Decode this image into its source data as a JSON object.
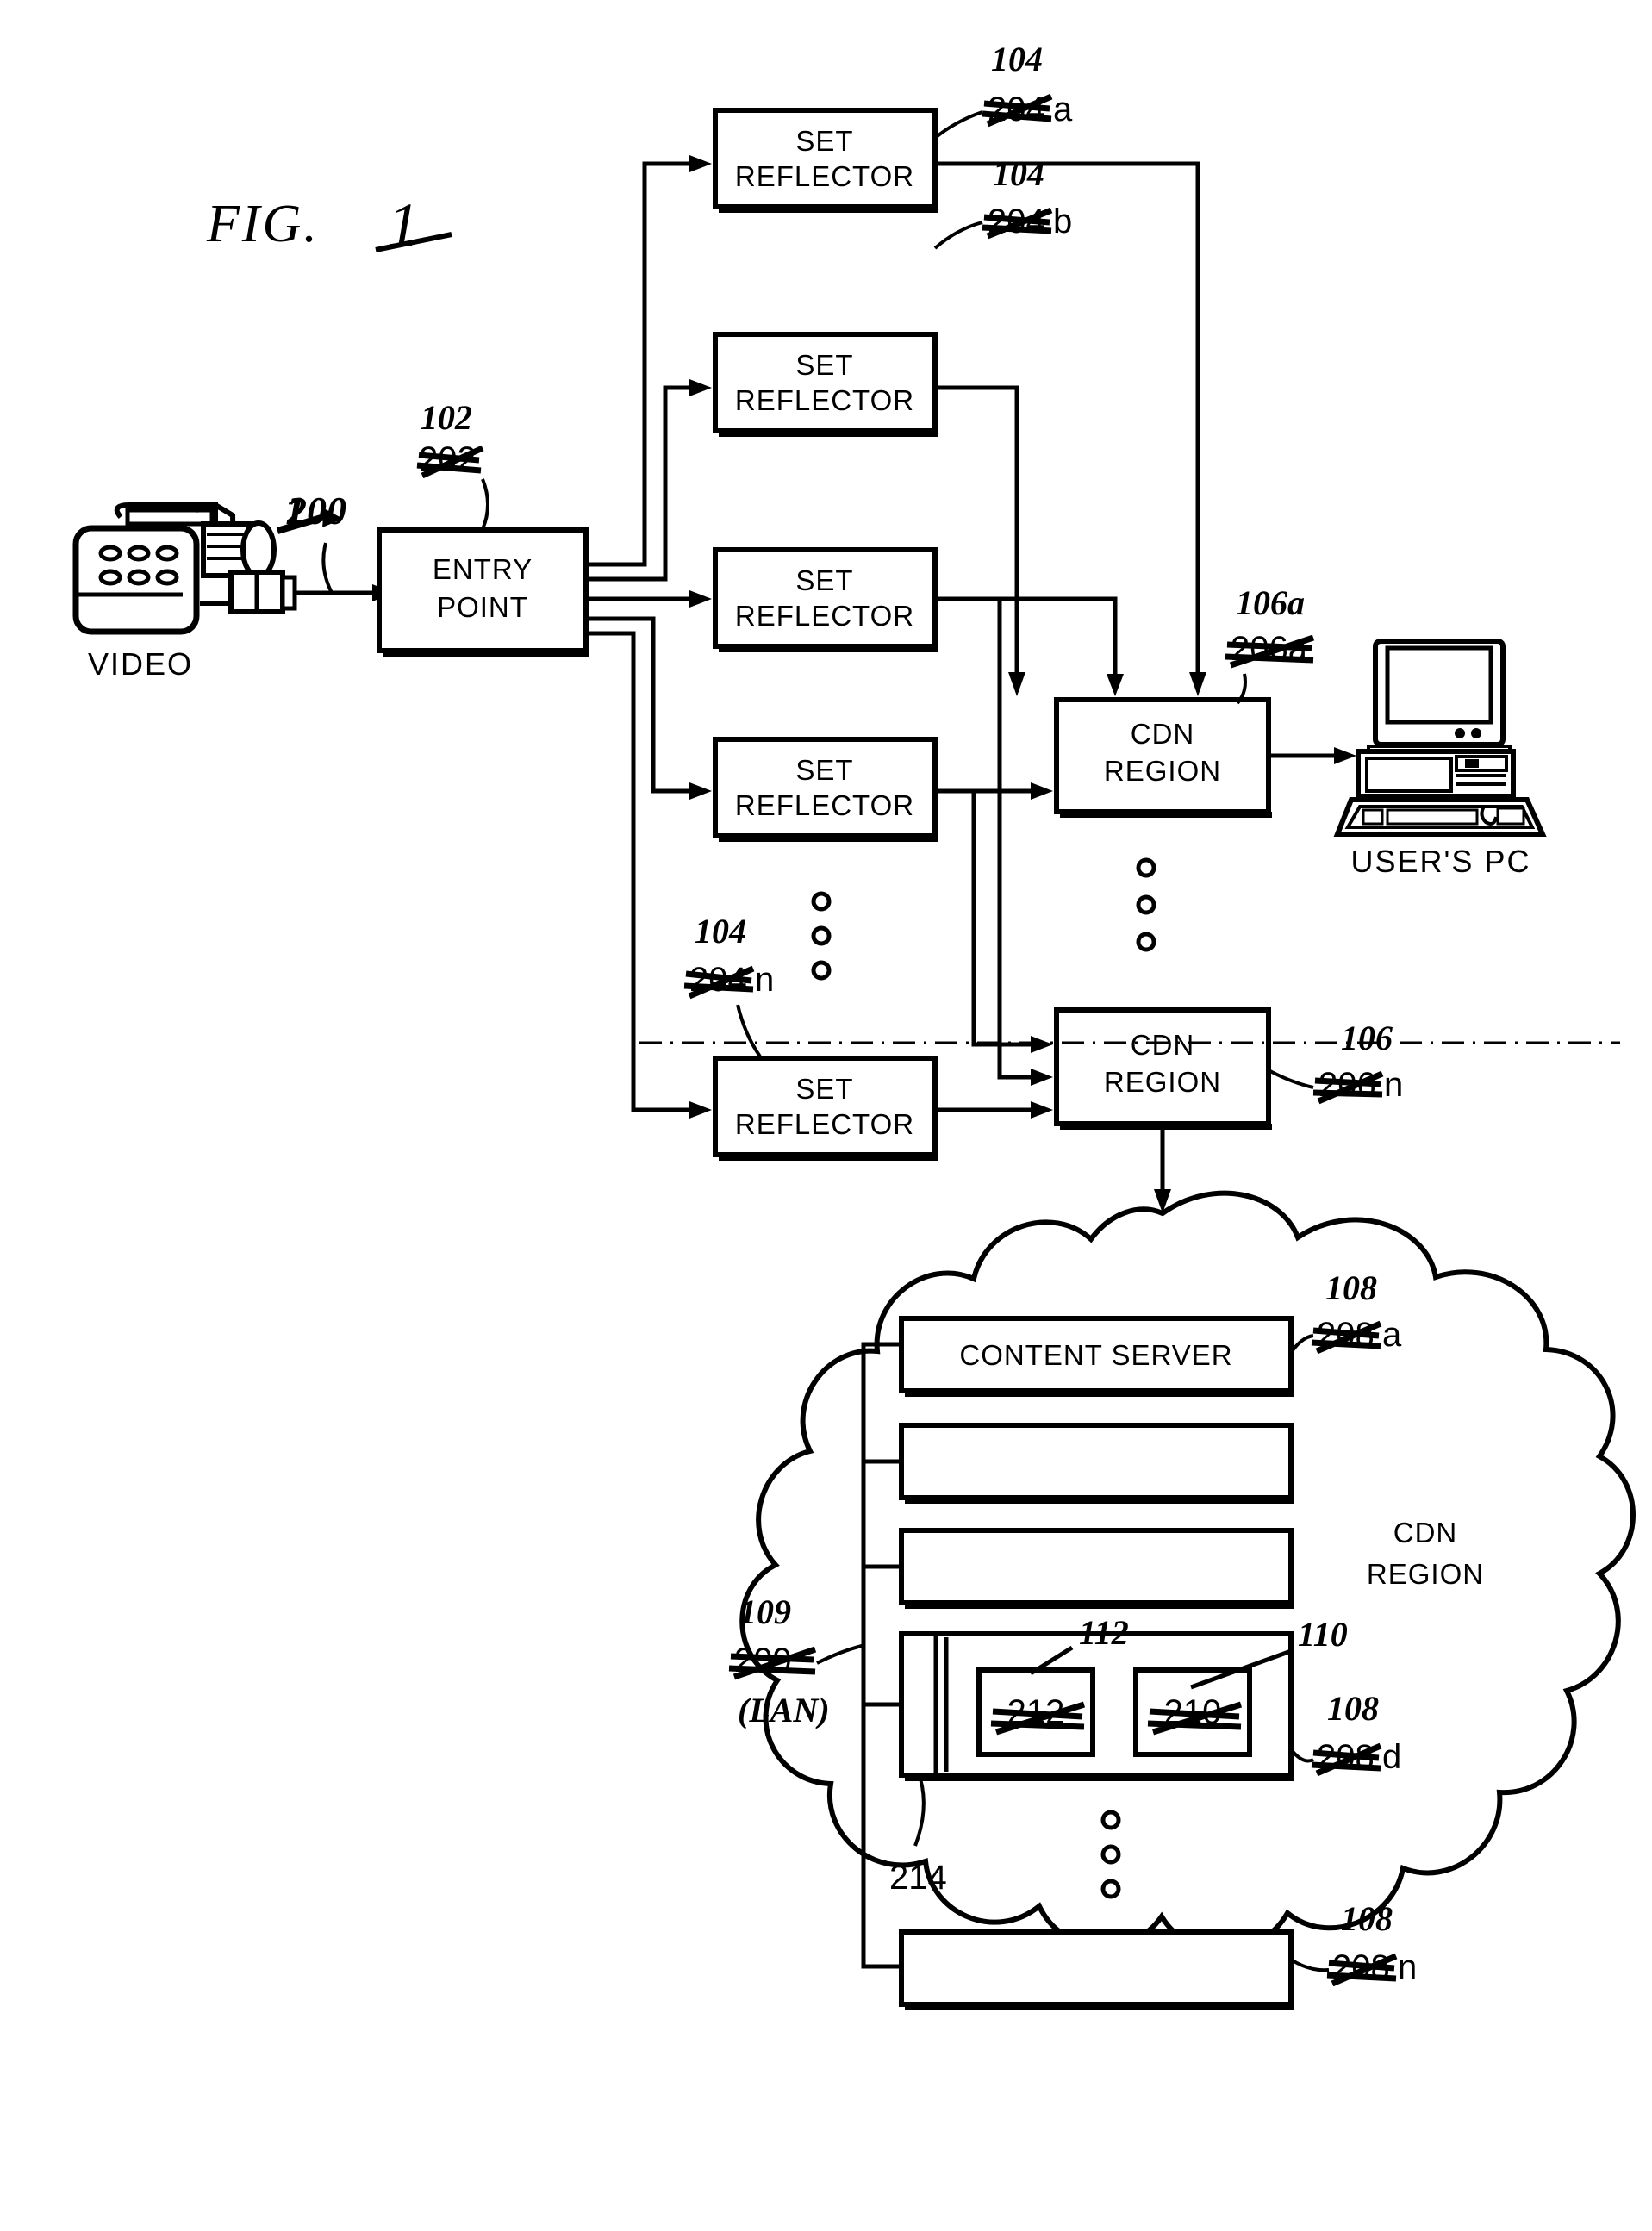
{
  "figure": {
    "title": "FIG.",
    "title_number": "1"
  },
  "nodes": {
    "video_camera_label": "VIDEO",
    "entry_point": {
      "line1": "ENTRY",
      "line2": "POINT"
    },
    "set_reflector": {
      "line1": "SET",
      "line2": "REFLECTOR"
    },
    "cdn_region": {
      "line1": "CDN",
      "line2": "REGION"
    },
    "users_pc_label": "USER'S  PC",
    "content_server": "CONTENT  SERVER",
    "cloud_caption": {
      "line1": "CDN",
      "line2": "REGION"
    },
    "lan_caption": "(LAN)"
  },
  "reference_numerals": {
    "video_feed": {
      "corrected": "1",
      "struck": "200"
    },
    "entry_point": {
      "corrected": "102",
      "struck": "202"
    },
    "reflector_a": {
      "corrected": "104",
      "struck": "204",
      "suffix": "a"
    },
    "reflector_b": {
      "corrected": "104",
      "struck": "204",
      "suffix": "b"
    },
    "reflector_n": {
      "corrected": "104",
      "struck": "204",
      "suffix": "n"
    },
    "cdn_region_a": {
      "corrected": "106a",
      "struck": "206a",
      "suffix": ""
    },
    "cdn_region_n": {
      "corrected": "106",
      "struck": "206",
      "suffix": "n"
    },
    "content_server_a": {
      "corrected": "108",
      "struck": "208",
      "suffix": "a"
    },
    "server_d": {
      "corrected": "108",
      "struck": "208",
      "suffix": "d"
    },
    "server_n": {
      "corrected": "108",
      "struck": "208",
      "suffix": "n"
    },
    "lan": {
      "corrected": "109",
      "struck": "209"
    },
    "inner_box_left": {
      "corrected": "112",
      "struck": "212"
    },
    "inner_box_right": {
      "corrected": "110",
      "struck": "210"
    },
    "bus_214": "214"
  },
  "colors": {
    "ink": "#000000",
    "paper": "#ffffff"
  },
  "ellipsis_glyph": "○"
}
